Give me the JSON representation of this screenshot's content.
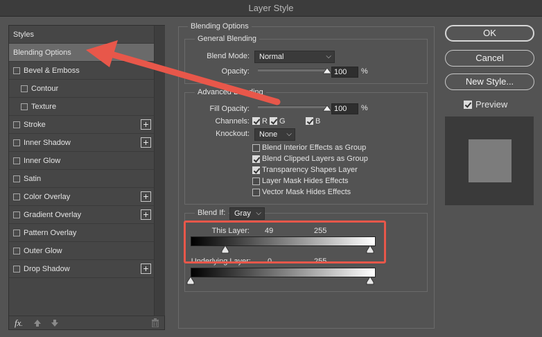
{
  "window": {
    "title": "Layer Style"
  },
  "left_panel": {
    "styles_header": "Styles",
    "items": [
      {
        "label": "Blending Options",
        "checkbox": false,
        "indent": false,
        "plus": false,
        "selected": true
      },
      {
        "label": "Bevel & Emboss",
        "checkbox": true,
        "indent": false,
        "plus": false
      },
      {
        "label": "Contour",
        "checkbox": true,
        "indent": true,
        "plus": false
      },
      {
        "label": "Texture",
        "checkbox": true,
        "indent": true,
        "plus": false
      },
      {
        "label": "Stroke",
        "checkbox": true,
        "indent": false,
        "plus": true
      },
      {
        "label": "Inner Shadow",
        "checkbox": true,
        "indent": false,
        "plus": true
      },
      {
        "label": "Inner Glow",
        "checkbox": true,
        "indent": false,
        "plus": false
      },
      {
        "label": "Satin",
        "checkbox": true,
        "indent": false,
        "plus": false
      },
      {
        "label": "Color Overlay",
        "checkbox": true,
        "indent": false,
        "plus": true
      },
      {
        "label": "Gradient Overlay",
        "checkbox": true,
        "indent": false,
        "plus": true
      },
      {
        "label": "Pattern Overlay",
        "checkbox": true,
        "indent": false,
        "plus": false
      },
      {
        "label": "Outer Glow",
        "checkbox": true,
        "indent": false,
        "plus": false
      },
      {
        "label": "Drop Shadow",
        "checkbox": true,
        "indent": false,
        "plus": true
      }
    ],
    "footer": {
      "fx_label": "fx",
      "fx_sub": "."
    }
  },
  "blending": {
    "section_title": "Blending Options",
    "general_title": "General Blending",
    "blend_mode_label": "Blend Mode:",
    "blend_mode_value": "Normal",
    "opacity_label": "Opacity:",
    "opacity_value": "100",
    "opacity_unit": "%",
    "opacity_fraction": 1.0,
    "advanced_title": "Advanced Blending",
    "fill_opacity_label": "Fill Opacity:",
    "fill_opacity_value": "100",
    "fill_opacity_unit": "%",
    "fill_opacity_fraction": 1.0,
    "channels_label": "Channels:",
    "channels": [
      {
        "label": "R",
        "checked": true
      },
      {
        "label": "G",
        "checked": true
      },
      {
        "label": "B",
        "checked": true
      }
    ],
    "knockout_label": "Knockout:",
    "knockout_value": "None",
    "options": [
      {
        "label": "Blend Interior Effects as Group",
        "checked": false
      },
      {
        "label": "Blend Clipped Layers as Group",
        "checked": true
      },
      {
        "label": "Transparency Shapes Layer",
        "checked": true
      },
      {
        "label": "Layer Mask Hides Effects",
        "checked": false
      },
      {
        "label": "Vector Mask Hides Effects",
        "checked": false
      }
    ],
    "blend_if_label": "Blend If:",
    "blend_if_value": "Gray",
    "this_layer_label": "This Layer:",
    "this_layer_low": "49",
    "this_layer_high": "255",
    "underlying_label": "Underlying Layer:",
    "underlying_low": "0",
    "underlying_high": "255"
  },
  "buttons": {
    "ok": "OK",
    "cancel": "Cancel",
    "new_style": "New Style...",
    "preview_label": "Preview",
    "preview_checked": true
  },
  "colors": {
    "annotation_red": "#e8574a"
  }
}
